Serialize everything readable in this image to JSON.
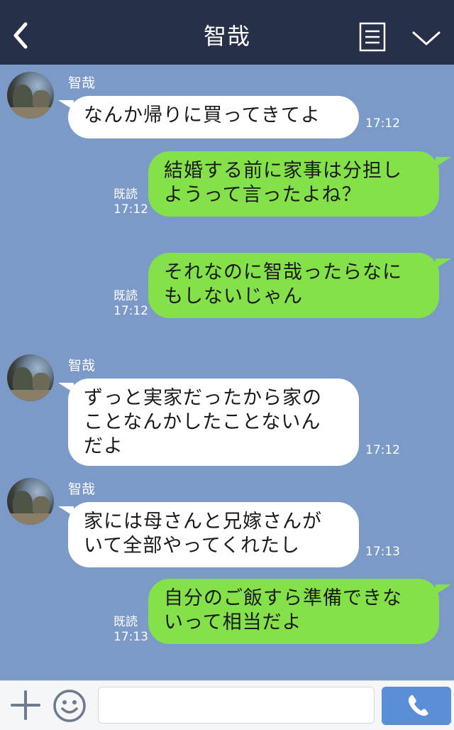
{
  "header": {
    "title": "智哉",
    "back_icon": "chevron-left-icon",
    "menu_icon": "menu-list-icon",
    "collapse_icon": "chevron-down-icon"
  },
  "messages": [
    {
      "side": "left",
      "sender": "智哉",
      "text": "なんか帰りに買ってきてよ",
      "time": "17:12"
    },
    {
      "side": "right",
      "text": "結婚する前に家事は分担し\nようって言ったよね？",
      "read": "既読",
      "time": "17:12"
    },
    {
      "side": "right",
      "text": "それなのに智哉ったらなに\nもしないじゃん",
      "read": "既読",
      "time": "17:12"
    },
    {
      "side": "left",
      "sender": "智哉",
      "text": "ずっと実家だったから家の\nことなんかしたことないん\nだよ",
      "time": "17:12"
    },
    {
      "side": "left",
      "sender": "智哉",
      "text": "家には母さんと兄嫁さんが\nいて全部やってくれたし",
      "time": "17:13"
    },
    {
      "side": "right",
      "text": "自分のご飯すら準備できな\nいって相当だよ",
      "read": "既読",
      "time": "17:13"
    }
  ],
  "footer": {
    "plus_icon": "plus-icon",
    "emoji_icon": "smiley-icon",
    "input_value": "",
    "call_icon": "phone-icon"
  },
  "colors": {
    "header_bg": "#263149",
    "chat_bg": "#7b9ac8",
    "sent_bubble": "#84e14a",
    "received_bubble": "#ffffff",
    "call_button": "#5a8ed7"
  }
}
